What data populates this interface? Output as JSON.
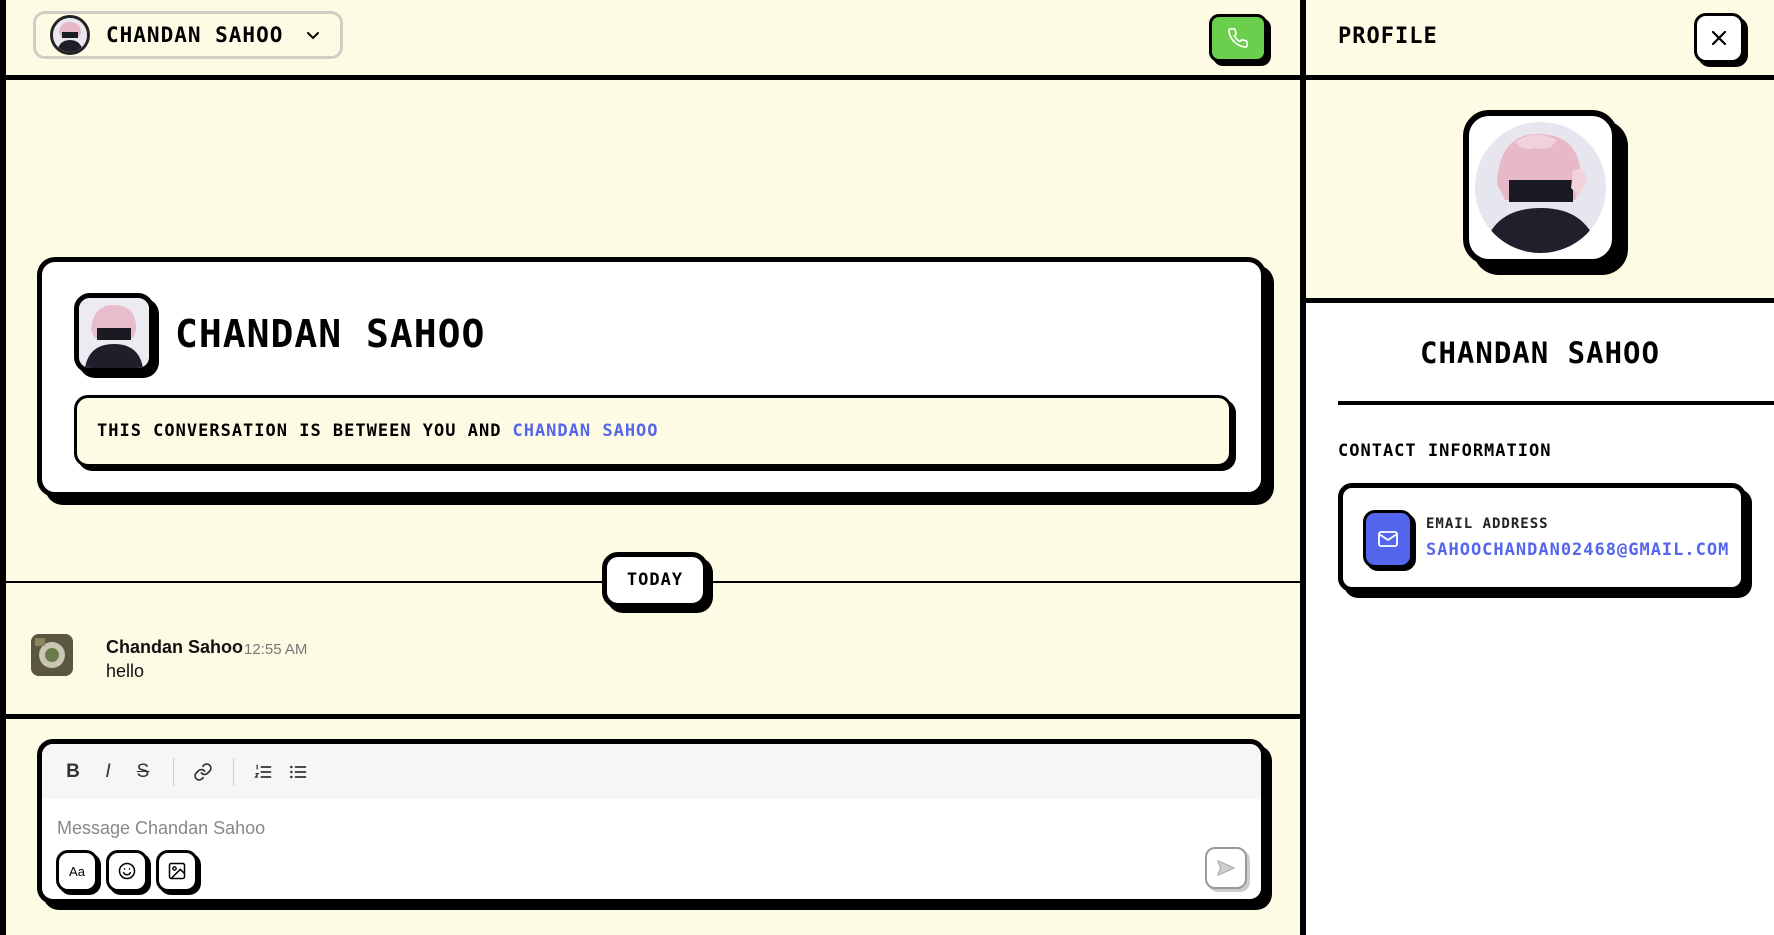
{
  "header": {
    "user_name": "CHANDAN SAHOO"
  },
  "intro": {
    "name": "CHANDAN SAHOO",
    "note_prefix": "THIS CONVERSATION IS BETWEEN YOU AND",
    "note_link": "CHANDAN SAHOO"
  },
  "divider": {
    "label": "TODAY"
  },
  "message": {
    "author": "Chandan Sahoo",
    "time": "12:55 AM",
    "text": "hello"
  },
  "composer": {
    "placeholder": "Message Chandan Sahoo",
    "format_label": "Aa",
    "toolbar": {
      "bold": "B",
      "italic": "I",
      "strike": "S"
    }
  },
  "profile": {
    "title": "PROFILE",
    "name": "CHANDAN SAHOO",
    "contact_heading": "CONTACT INFORMATION",
    "email_label": "EMAIL ADDRESS",
    "email_value": "SAHOOCHANDAN02468@GMAIL.COM"
  },
  "colors": {
    "background": "#fefbe5",
    "accent": "#5566ee",
    "call_button": "#6bcf4d",
    "border": "#000000"
  },
  "icons": [
    "chevron-down-icon",
    "phone-icon",
    "bold-icon",
    "italic-icon",
    "strikethrough-icon",
    "link-icon",
    "ordered-list-icon",
    "bullet-list-icon",
    "emoji-icon",
    "image-icon",
    "send-icon",
    "close-icon",
    "mail-icon"
  ]
}
